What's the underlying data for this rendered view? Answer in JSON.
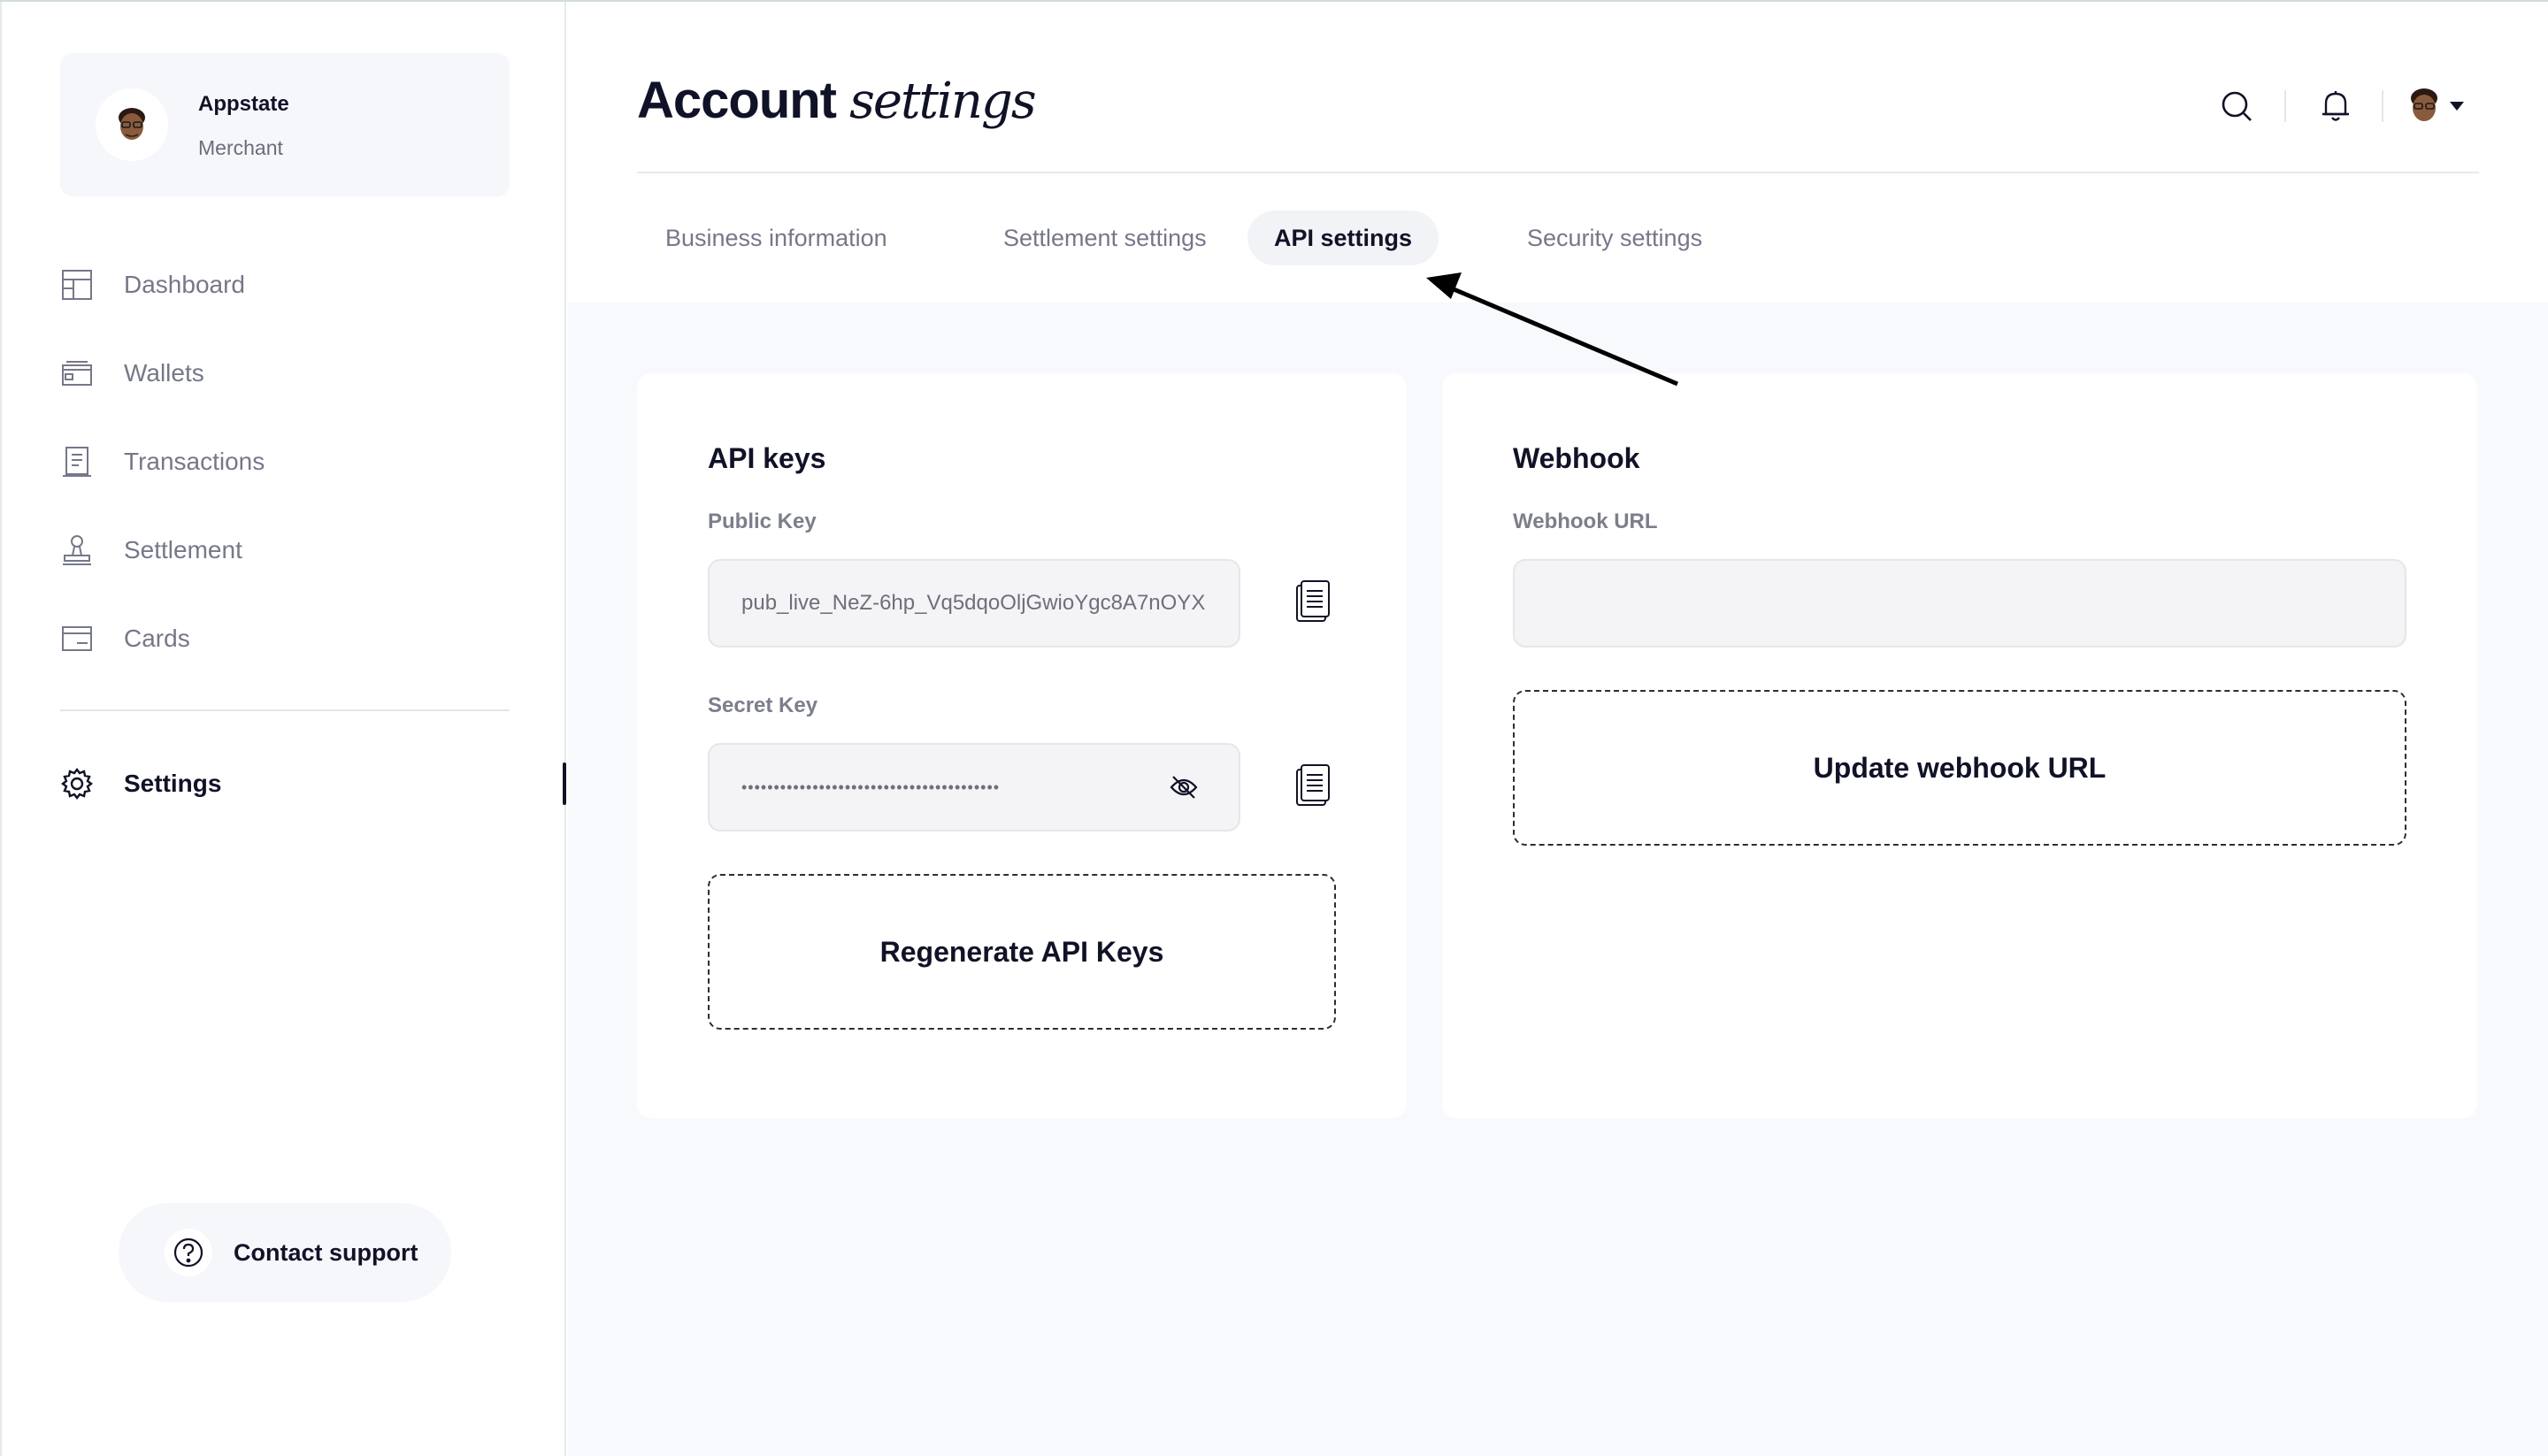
{
  "profile": {
    "name": "Appstate",
    "role": "Merchant",
    "avatar_icon": "memoji-avatar-icon"
  },
  "sidebar": {
    "items": [
      {
        "label": "Dashboard",
        "icon": "dashboard-icon"
      },
      {
        "label": "Wallets",
        "icon": "wallet-icon"
      },
      {
        "label": "Transactions",
        "icon": "receipt-icon"
      },
      {
        "label": "Settlement",
        "icon": "stamp-icon"
      },
      {
        "label": "Cards",
        "icon": "card-icon"
      },
      {
        "label": "Settings",
        "icon": "gear-icon",
        "active": true
      }
    ],
    "support_label": "Contact support"
  },
  "header": {
    "title_bold": "Account",
    "title_italic": "settings",
    "icons": [
      "search-icon",
      "bell-icon",
      "avatar-icon",
      "caret-down-icon"
    ]
  },
  "tabs": [
    {
      "label": "Business information"
    },
    {
      "label": "Settlement settings"
    },
    {
      "label": "API settings",
      "active": true
    },
    {
      "label": "Security settings"
    }
  ],
  "api_keys": {
    "title": "API keys",
    "public_key_label": "Public Key",
    "public_key_value": "pub_live_NeZ-6hp_Vq5dqoOljGwioYgc8A7nOYX",
    "secret_key_label": "Secret Key",
    "secret_key_value": "••••••••••••••••••••••••••••••••••••••••",
    "regenerate_label": "Regenerate API Keys"
  },
  "webhook": {
    "title": "Webhook",
    "url_label": "Webhook URL",
    "url_value": "",
    "update_label": "Update webhook URL"
  },
  "colors": {
    "text": "#101228",
    "muted": "#75788a",
    "bg": "#f8f9fc",
    "accent": "#101228"
  }
}
